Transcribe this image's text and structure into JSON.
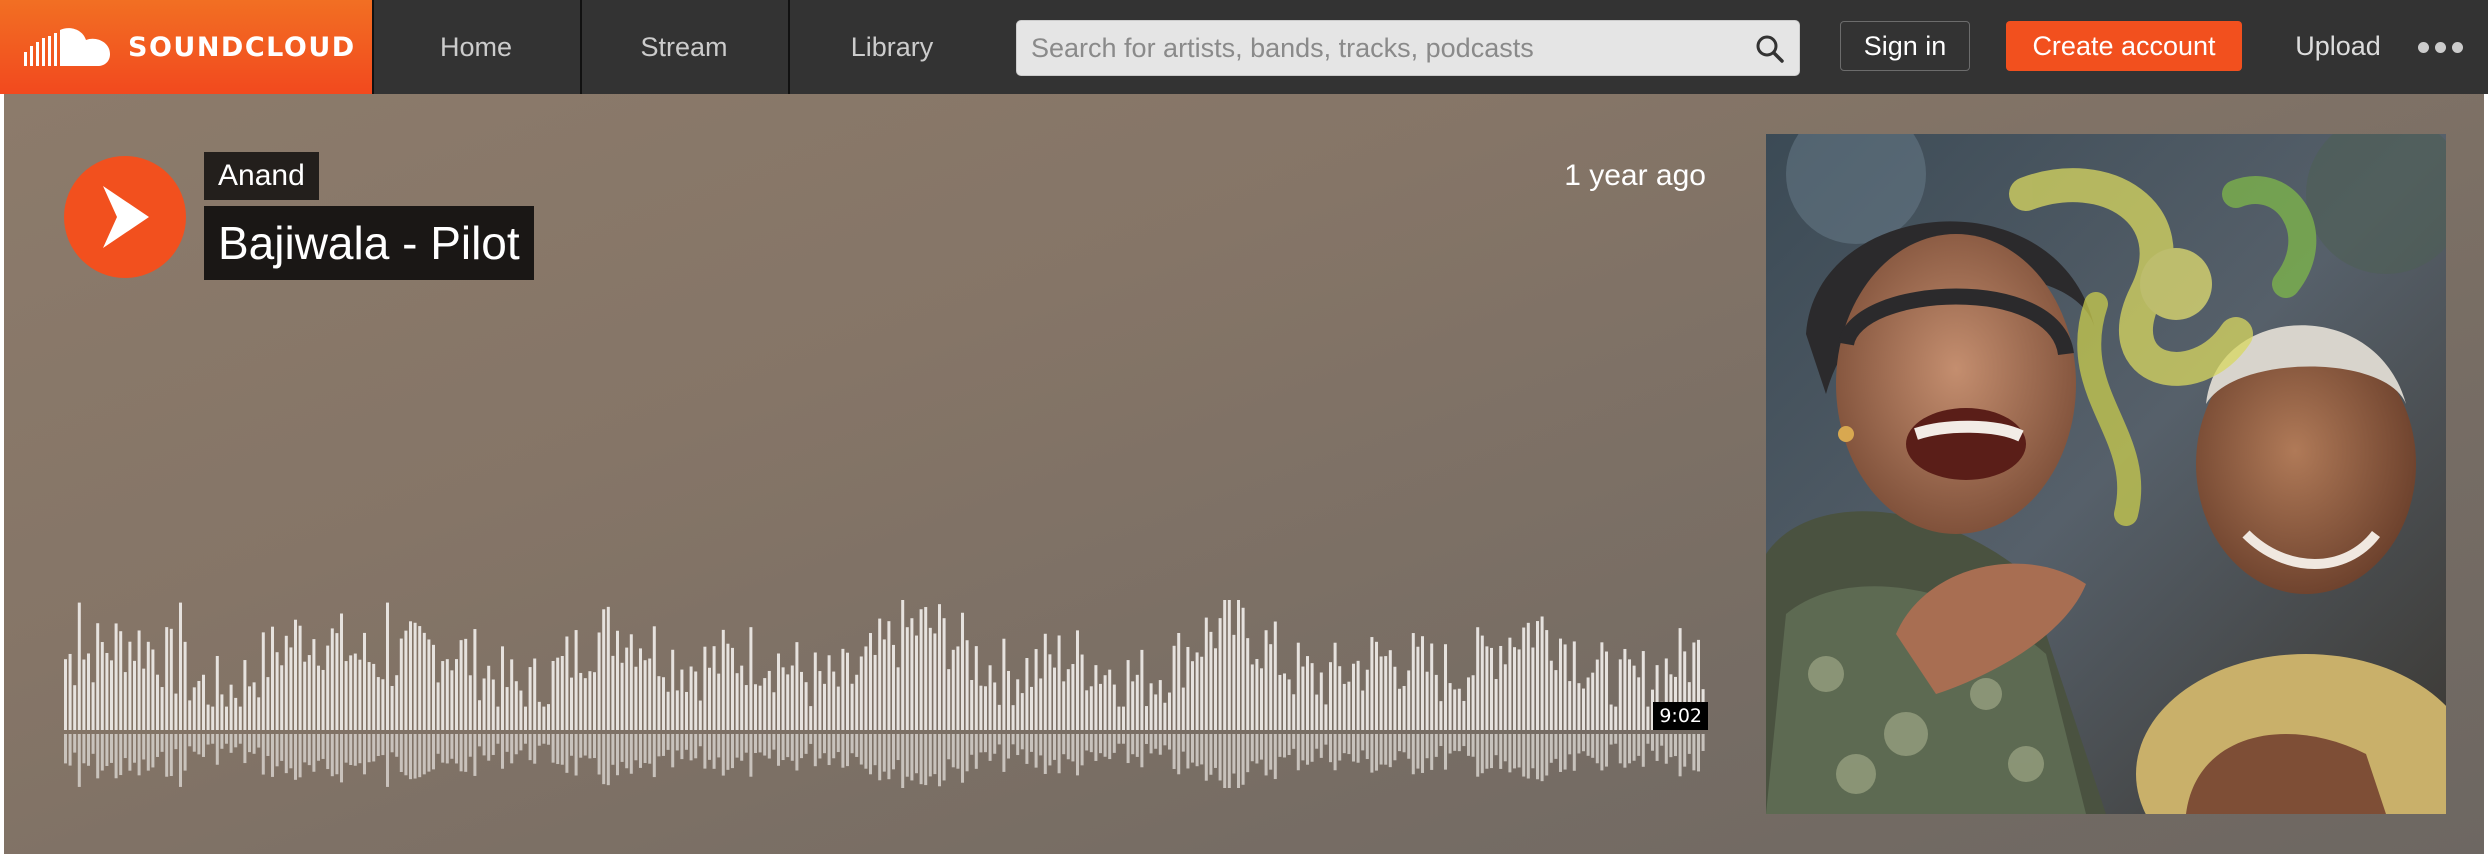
{
  "brand": {
    "name": "SOUNDCLOUD",
    "accent": "#f2501e",
    "topbar_bg": "#333333"
  },
  "nav": {
    "items": [
      {
        "label": "Home"
      },
      {
        "label": "Stream"
      },
      {
        "label": "Library"
      }
    ],
    "search_placeholder": "Search for artists, bands, tracks, podcasts",
    "search_icon": "magnifier-icon",
    "sign_in": "Sign in",
    "create_account": "Create account",
    "upload": "Upload",
    "more_icon": "ellipsis-icon"
  },
  "track": {
    "artist": "Anand",
    "title": "Bajiwala - Pilot",
    "posted": "1 year ago",
    "duration": "9:02",
    "play_icon": "play-icon",
    "artwork_description_icon": "cover-art-image"
  }
}
